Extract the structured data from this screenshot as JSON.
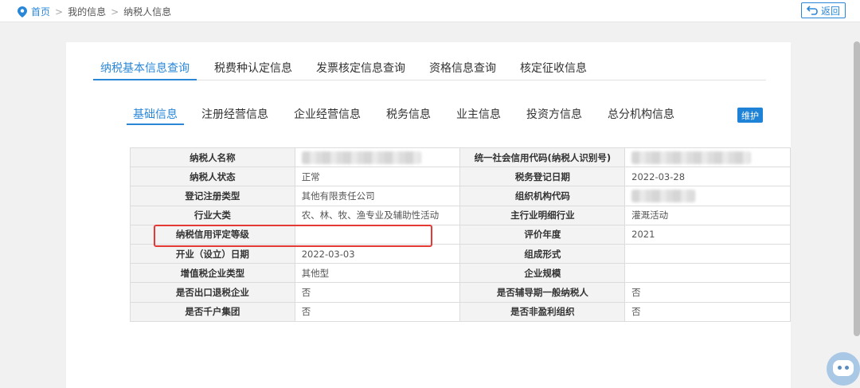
{
  "breadcrumb": {
    "home": "首页",
    "level1": "我的信息",
    "level2": "纳税人信息"
  },
  "back_label": "返回",
  "main_tabs": [
    "纳税基本信息查询",
    "税费种认定信息",
    "发票核定信息查询",
    "资格信息查询",
    "核定征收信息"
  ],
  "sub_tabs": [
    "基础信息",
    "注册经营信息",
    "企业经营信息",
    "税务信息",
    "业主信息",
    "投资方信息",
    "总分机构信息"
  ],
  "maintain_label": "维护",
  "rows": [
    {
      "l1": "纳税人名称",
      "v1": "",
      "l2": "统一社会信用代码(纳税人识别号)",
      "v2": ""
    },
    {
      "l1": "纳税人状态",
      "v1": "正常",
      "l2": "税务登记日期",
      "v2": "2022-03-28"
    },
    {
      "l1": "登记注册类型",
      "v1": "其他有限责任公司",
      "l2": "组织机构代码",
      "v2": ""
    },
    {
      "l1": "行业大类",
      "v1": "农、林、牧、渔专业及辅助性活动",
      "l2": "主行业明细行业",
      "v2": "灌溉活动"
    },
    {
      "l1": "纳税信用评定等级",
      "v1": "",
      "l2": "评价年度",
      "v2": "2021"
    },
    {
      "l1": "开业（设立）日期",
      "v1": "2022-03-03",
      "l2": "组成形式",
      "v2": ""
    },
    {
      "l1": "增值税企业类型",
      "v1": "其他型",
      "l2": "企业规模",
      "v2": ""
    },
    {
      "l1": "是否出口退税企业",
      "v1": "否",
      "l2": "是否辅导期一般纳税人",
      "v2": "否"
    },
    {
      "l1": "是否千户集团",
      "v1": "否",
      "l2": "是否非盈利组织",
      "v2": "否"
    }
  ],
  "colors": {
    "accent": "#2a87d8",
    "highlight": "#e53935"
  }
}
